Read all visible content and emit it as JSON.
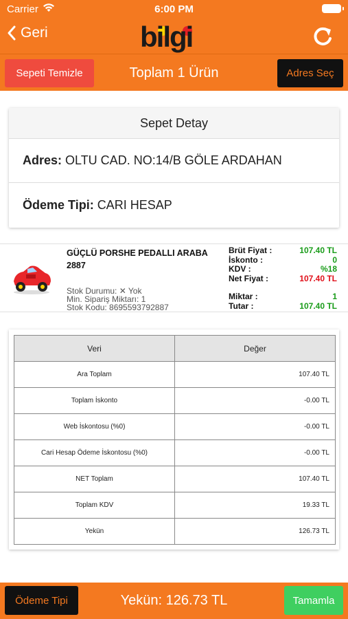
{
  "status_bar": {
    "carrier": "Carrier",
    "time": "6:00 PM"
  },
  "nav": {
    "back_label": "Geri",
    "logo_text": "bilgi"
  },
  "subbar": {
    "clear_label": "Sepeti Temizle",
    "title": "Toplam 1 Ürün",
    "address_label": "Adres Seç"
  },
  "detail": {
    "header": "Sepet Detay",
    "address_key": "Adres:",
    "address_value": "OLTU CAD. NO:14/B GÖLE ARDAHAN",
    "payment_key": "Ödeme Tipi:",
    "payment_value": "CARI HESAP"
  },
  "product": {
    "name": "GÜÇLÜ PORSHE PEDALLI ARABA 2887",
    "stock": "Stok Durumu: ✕ Yok",
    "min_order": "Min. Sipariş Miktarı: 1",
    "stock_code": "Stok Kodu: 8695593792887",
    "labels": {
      "gross": "Brüt Fiyat :",
      "discount": "İskonto :",
      "kdv": "KDV :",
      "net": "Net Fiyat :",
      "qty": "Miktar :",
      "amount": "Tutar :"
    },
    "values": {
      "gross": "107.40 TL",
      "discount": "0",
      "kdv": "%18",
      "net": "107.40 TL",
      "qty": "1",
      "amount": "107.40 TL"
    }
  },
  "summary": {
    "headers": [
      "Veri",
      "Değer"
    ],
    "rows": [
      [
        "Ara Toplam",
        "107.40 TL"
      ],
      [
        "Toplam İskonto",
        "-0.00 TL"
      ],
      [
        "Web İskontosu (%0)",
        "-0.00 TL"
      ],
      [
        "Cari Hesap Ödeme İskontosu (%0)",
        "-0.00 TL"
      ],
      [
        "NET Toplam",
        "107.40 TL"
      ],
      [
        "Toplam KDV",
        "19.33 TL"
      ],
      [
        "Yekün",
        "126.73 TL"
      ]
    ]
  },
  "bottom": {
    "payment_label": "Ödeme Tipi",
    "total_text": "Yekün: 126.73 TL",
    "done_label": "Tamamla"
  },
  "colors": {
    "brand": "#f47920",
    "danger": "#ef4b3e",
    "success": "#3fcf60",
    "dark": "#111111"
  }
}
